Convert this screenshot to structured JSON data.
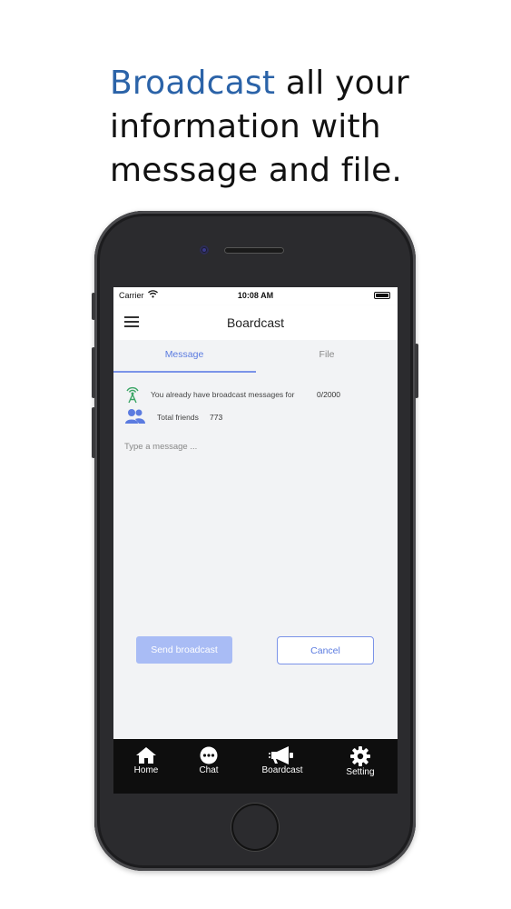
{
  "headline": {
    "accent": "Broadcast",
    "rest": " all your information with message and file."
  },
  "status_bar": {
    "carrier": "Carrier",
    "time": "10:08 AM",
    "wifi_icon": "wifi-icon",
    "battery_icon": "battery-icon"
  },
  "nav": {
    "title": "Boardcast",
    "menu_icon": "hamburger-menu-icon"
  },
  "tabs": [
    {
      "label": "Message",
      "active": true
    },
    {
      "label": "File",
      "active": false
    }
  ],
  "info": {
    "broadcast_text": "You already have broadcast messages for",
    "broadcast_count": "0/2000",
    "friends_label": "Total friends",
    "friends_count": "773"
  },
  "message_input": {
    "placeholder": "Type a message ..."
  },
  "buttons": {
    "send": "Send broadcast",
    "cancel": "Cancel"
  },
  "bottom_tabs": [
    {
      "label": "Home",
      "icon": "home-icon"
    },
    {
      "label": "Chat",
      "icon": "chat-icon"
    },
    {
      "label": "Boardcast",
      "icon": "megaphone-icon"
    },
    {
      "label": "Setting",
      "icon": "gear-icon"
    }
  ],
  "colors": {
    "accent": "#2b63a8",
    "primary": "#5b7be0",
    "send_button": "#a9bcf5",
    "tab_bar": "#0e0e0e"
  }
}
